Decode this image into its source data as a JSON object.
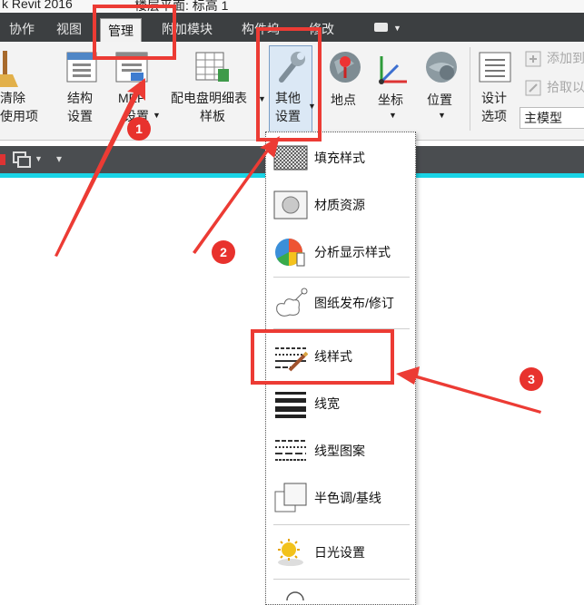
{
  "titlebar": {
    "text": "k Revit 2016",
    "view_text": "楼层平面: 标高 1"
  },
  "tabs": [
    "协作",
    "视图",
    "管理",
    "附加模块",
    "构件坞",
    "修改"
  ],
  "active_tab": "管理",
  "ribbon": {
    "purge": [
      "清除",
      "使用项"
    ],
    "structural": [
      "结构",
      "设置"
    ],
    "mep": [
      "MEP",
      "设置"
    ],
    "panel_schedule": [
      "配电盘明细表",
      "样板"
    ],
    "additional": [
      "其他",
      "设置"
    ],
    "location": "地点",
    "coordinates": "坐标",
    "position": "位置",
    "design_options": [
      "设计",
      "选项"
    ],
    "add_to_set": "添加到",
    "pick_to_edit": "拾取以",
    "main_model": "主模型"
  },
  "menu_items": [
    {
      "label": "填充样式",
      "icon": "fill-pattern-icon"
    },
    {
      "label": "材质资源",
      "icon": "material-asset-icon"
    },
    {
      "label": "分析显示样式",
      "icon": "analysis-display-icon"
    },
    {
      "label": "图纸发布/修订",
      "icon": "sheet-issues-icon"
    },
    {
      "label": "线样式",
      "icon": "line-styles-icon"
    },
    {
      "label": "线宽",
      "icon": "line-weights-icon"
    },
    {
      "label": "线型图案",
      "icon": "line-patterns-icon"
    },
    {
      "label": "半色调/基线",
      "icon": "halftone-underlay-icon"
    },
    {
      "label": "日光设置",
      "icon": "sun-settings-icon"
    }
  ],
  "annotations": {
    "step1": "1",
    "step2": "2",
    "step3": "3"
  },
  "colors": {
    "annotation_red": "#e8322d",
    "ribbon_bg": "#f3f3f3",
    "tabbar_bg": "#3c3f41",
    "accent_cyan": "#19d4e6"
  }
}
